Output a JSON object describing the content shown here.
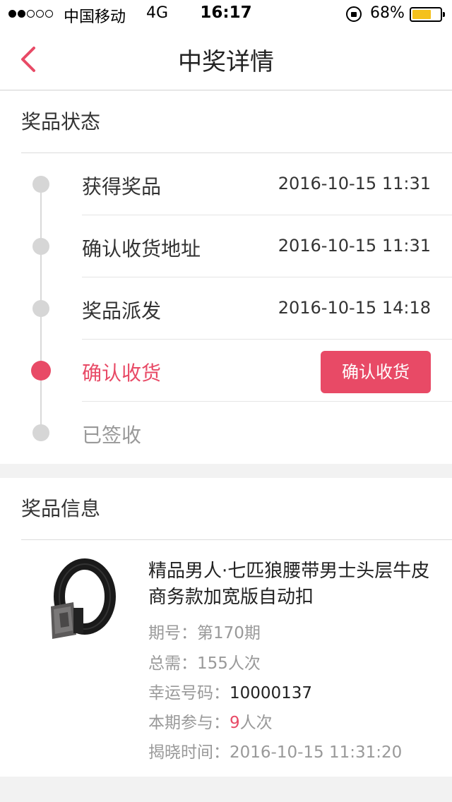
{
  "status_bar": {
    "carrier": "中国移动",
    "network": "4G",
    "time": "16:17",
    "battery": "68%",
    "battery_level": 0.68,
    "signal_bars": 2,
    "signal_total": 5,
    "icons": [
      "signal-dots-icon",
      "orientation-lock-icon",
      "battery-icon"
    ]
  },
  "nav": {
    "title": "中奖详情",
    "back_icon": "chevron-left-icon"
  },
  "prize_status": {
    "header": "奖品状态",
    "steps": [
      {
        "label": "获得奖品",
        "time": "2016-10-15 11:31",
        "state": "done"
      },
      {
        "label": "确认收货地址",
        "time": "2016-10-15 11:31",
        "state": "done"
      },
      {
        "label": "奖品派发",
        "time": "2016-10-15 14:18",
        "state": "done"
      },
      {
        "label": "确认收货",
        "time": "",
        "state": "current",
        "action": "确认收货"
      },
      {
        "label": "已签收",
        "time": "",
        "state": "pending"
      }
    ]
  },
  "prize_info": {
    "header": "奖品信息",
    "product": {
      "title": "精品男人·七匹狼腰带男士头层牛皮商务款加宽版自动扣",
      "image_icon": "belt-product-image"
    },
    "details": {
      "period_label": "期号：",
      "period_value": "第170期",
      "total_label": "总需：",
      "total_value": "155人次",
      "lucky_label": "幸运号码：",
      "lucky_value": "10000137",
      "join_label": "本期参与：",
      "join_count": "9",
      "join_unit": "人次",
      "reveal_label": "揭晓时间：",
      "reveal_value": "2016-10-15 11:31:20"
    }
  },
  "colors": {
    "accent": "#e84a66",
    "background": "#f2f2f2",
    "inactive_dot": "#d6d6d6"
  }
}
